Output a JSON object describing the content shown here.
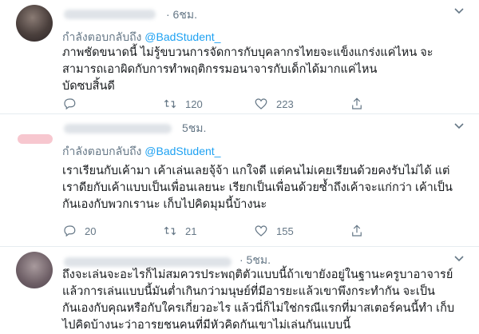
{
  "tweets": [
    {
      "time": "· 6ชม.",
      "reply_prefix": "กำลังตอบกลับถึง",
      "reply_handle": "@BadStudent_",
      "body": "ภาพชัดขนาดนี้ ไม่รู้ขบวนการจัดการกับบุคลากรไทยจะแข็งแกร่งแค่ไหน จะสามารถเอาผิดกับการทำพฤติกรรมอนาจารกับเด็กได้มากแค่ไหน\nบัดซบสิ้นดี",
      "replies": "",
      "retweets": "120",
      "likes": "223"
    },
    {
      "time": "5ชม.",
      "reply_prefix": "กำลังตอบกลับถึง",
      "reply_handle": "@BadStudent_",
      "body": "เราเรียนกับเค้ามา เค้าเล่นเลยจุ้จ้า แกใจดี แต่คนไม่เคยเรียนด้วยคงรับไม่ได้ แต่เราดียกับเค้าแบบเป็นเพื่อนเลยนะ เรียกเป็นเพื่อนด้วยซ้ำถึงเค้าจะแก่กว่า เค้าเป็นกันเองกับพวกเรานะ เก็บไปคิดมุมนี้บ้างนะ",
      "replies": "20",
      "retweets": "21",
      "likes": "155"
    },
    {
      "time": "· 5ชม.",
      "body": "ถึงจะเล่นจะอะไรก็ไม่สมควรประพฤติตัวแบบนี้ถ้าเขายังอยู่ในฐานะครูบาอาจารย์ แล้วการเล่นแบบนี้มันต่ำเกินกว่ามนุษย์ที่มีอารยะแล้วเขาพึงกระทำกัน จะเป็นกันเองกับคุณหรือกับใครเกี่ยวอะไร แล้วนี่ก็ไม่ใช่กรณีแรกที่มาสเตอร์คนนี้ทำ เก็บไปคิดบ้างนะว่าอารยชนคนที่มีหัวคิดกันเขาไม่เล่นกันแบบนี้"
    }
  ],
  "icons": {
    "reply": "reply-icon",
    "retweet": "retweet-icon",
    "like": "heart-icon",
    "more": "chevron-down-icon"
  },
  "colors": {
    "link": "#1da1f2",
    "secondary": "#657786",
    "text": "#14171a",
    "divider": "#e6ecf0"
  }
}
